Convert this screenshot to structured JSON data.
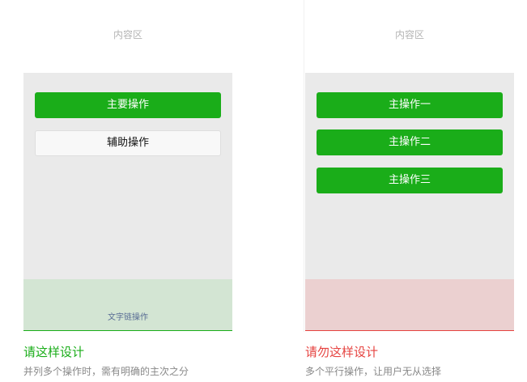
{
  "left_example": {
    "content_area_label": "内容区",
    "primary_button": "主要操作",
    "secondary_button": "辅助操作",
    "text_link": "文字链操作",
    "verdict": "请这样设计",
    "description": "并列多个操作时，需有明确的主次之分"
  },
  "right_example": {
    "content_area_label": "内容区",
    "buttons": [
      "主操作一",
      "主操作二",
      "主操作三"
    ],
    "verdict": "请勿这样设计",
    "description": "多个平行操作，让用户无从选择"
  },
  "colors": {
    "primary_green": "#1aad19",
    "warning_red": "#e64340",
    "good_bar_bg": "#d3e5d3",
    "bad_bar_bg": "#ebd0d0",
    "content_gray": "#eaeaea"
  }
}
